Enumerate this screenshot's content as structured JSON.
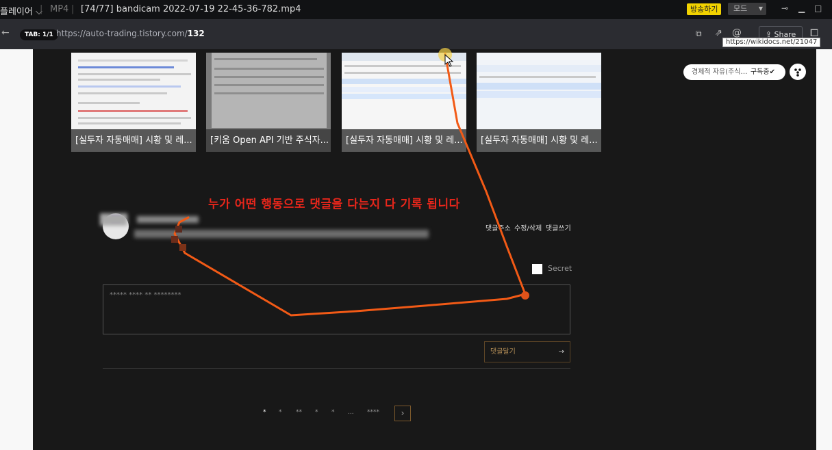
{
  "player": {
    "menu_label": "플레이어",
    "format": "MP4",
    "title": "[74/77]  bandicam  2022-07-19 22-45-36-782.mp4",
    "broadcast_label": "방송하기",
    "mode_label": "모드"
  },
  "browser": {
    "tab_badge": "TAB: 1/1",
    "url_prefix": "https://auto-trading.tistory.com/",
    "url_path": "132",
    "share_label": "Share",
    "tooltip": "https://wikidocs.net/21047"
  },
  "related": [
    {
      "caption": "[실두자 자동매매] 시황 및 레..."
    },
    {
      "caption": "[키움 Open API 기반 주식자..."
    },
    {
      "caption": "[실두자 자동매매] 시황 및 레..."
    },
    {
      "caption": "[실두자 자동매매] 시황 및 레..."
    }
  ],
  "subscribe": {
    "name": "경제적 자유(주식…",
    "label": "구독중"
  },
  "annotation": "누가 어떤 행동으로 댓글을 다는지 다 기록 됩니다",
  "comment": {
    "actions": [
      "댓글주소",
      "수정/삭제",
      "댓글쓰기"
    ],
    "secret_label": "Secret",
    "placeholder": "***** **** ** ********",
    "submit_label": "댓글달기",
    "submit_arrow": "→"
  },
  "pagination": {
    "items": [
      "*",
      "*",
      "**",
      "*",
      "*",
      "...",
      "****"
    ],
    "next": "›"
  },
  "colors": {
    "annotation_red": "#e8261b",
    "cursor_trail": "#f25a16",
    "broadcast_yellow": "#f2d200"
  }
}
